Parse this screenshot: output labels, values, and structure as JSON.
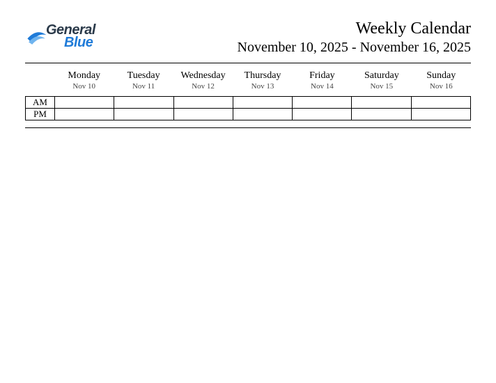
{
  "logo": {
    "line1": "General",
    "line2": "Blue"
  },
  "header": {
    "title": "Weekly Calendar",
    "date_range": "November 10, 2025 - November 16, 2025"
  },
  "periods": [
    "AM",
    "PM"
  ],
  "days": [
    {
      "name": "Monday",
      "date": "Nov 10"
    },
    {
      "name": "Tuesday",
      "date": "Nov 11"
    },
    {
      "name": "Wednesday",
      "date": "Nov 12"
    },
    {
      "name": "Thursday",
      "date": "Nov 13"
    },
    {
      "name": "Friday",
      "date": "Nov 14"
    },
    {
      "name": "Saturday",
      "date": "Nov 15"
    },
    {
      "name": "Sunday",
      "date": "Nov 16"
    }
  ]
}
